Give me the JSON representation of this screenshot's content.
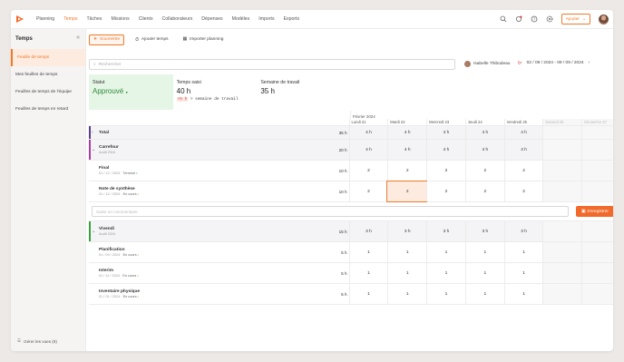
{
  "nav": {
    "items": [
      "Planning",
      "Temps",
      "Tâches",
      "Missions",
      "Clients",
      "Collaborateurs",
      "Dépenses",
      "Modèles",
      "Imports",
      "Exports"
    ],
    "active": "Temps",
    "add_label": "Ajouter"
  },
  "sidebar": {
    "title": "Temps",
    "items": [
      {
        "label": "Feuille de temps",
        "active": true
      },
      {
        "label": "Mes feuilles de temps",
        "active": false
      },
      {
        "label": "Feuilles de temps de l'équipe",
        "active": false
      },
      {
        "label": "Feuilles de temps en retard",
        "active": false
      }
    ],
    "footer": "Gérer les vues (9)"
  },
  "toolbar": {
    "submit": "Soumettre",
    "add_time": "Ajouter temps",
    "import_planning": "Importer planning"
  },
  "search": {
    "placeholder": "Rechercher"
  },
  "user": {
    "name": "Isabelle Thibodeau"
  },
  "date_range": "02 / 09 / 2024 - 09 / 09 / 2024",
  "cards": {
    "status_label": "Statut",
    "status_value": "Approuvé",
    "time_label": "Temps saisi",
    "time_value": "40 h",
    "time_delta": "+5 h",
    "time_delta_text": " > semaine de travail",
    "week_label": "Semaine de travail",
    "week_value": "35 h"
  },
  "grid": {
    "month": "Février 2024",
    "days": [
      "Lundi 21",
      "Mardi 22",
      "Mercredi 23",
      "Jeudi 24",
      "Vendredi 25",
      "Samedi 26",
      "Dimanche 27"
    ],
    "total_row": {
      "label": "Total",
      "total": "35 h",
      "values": [
        "4 h",
        "4 h",
        "4 h",
        "4 h",
        "4 h",
        "",
        ""
      ]
    },
    "clients": [
      {
        "name": "Carrefour",
        "sub": "Audit 2024",
        "accent": "#b03aa0",
        "total": "20 h",
        "values": [
          "4 h",
          "4 h",
          "4 h",
          "4 h",
          "4 h",
          "",
          ""
        ],
        "tasks": [
          {
            "name": "Final",
            "date": "01 / 12 / 2024",
            "status": "Terminé",
            "status_color": "#3a8e3a",
            "total": "10 h",
            "values": [
              "2",
              "2",
              "2",
              "2",
              "2",
              "",
              ""
            ]
          },
          {
            "name": "Note de synthèse",
            "date": "01 / 12 / 2024",
            "status": "En cours",
            "status_color": "#e08a2a",
            "total": "10 h",
            "values": [
              "2",
              "2",
              "2",
              "2",
              "2",
              "",
              ""
            ],
            "selected": 1
          }
        ]
      },
      {
        "name": "Vivendi",
        "sub": "Audit 2024",
        "accent": "#3aa03a",
        "total": "15 h",
        "values": [
          "3 h",
          "3 h",
          "3 h",
          "3 h",
          "3 h",
          "",
          ""
        ],
        "tasks": [
          {
            "name": "Planification",
            "date": "01 / 09 / 2024",
            "status": "En cours",
            "status_color": "#e08a2a",
            "total": "5 h",
            "values": [
              "1",
              "1",
              "1",
              "1",
              "1",
              "",
              ""
            ]
          },
          {
            "name": "Interim",
            "date": "01 / 11 / 2024",
            "status": "En cours",
            "status_color": "#e08a2a",
            "total": "5 h",
            "values": [
              "1",
              "1",
              "1",
              "1",
              "1",
              "",
              ""
            ]
          },
          {
            "name": "Inventaire physique",
            "date": "01 / 01 / 2024",
            "status": "En cours",
            "status_color": "#e08a2a",
            "total": "5 h",
            "values": [
              "1",
              "1",
              "1",
              "1",
              "1",
              "",
              ""
            ]
          }
        ]
      }
    ],
    "comment_placeholder": "Saisir un commentaire",
    "save_label": "Enregistrer"
  }
}
